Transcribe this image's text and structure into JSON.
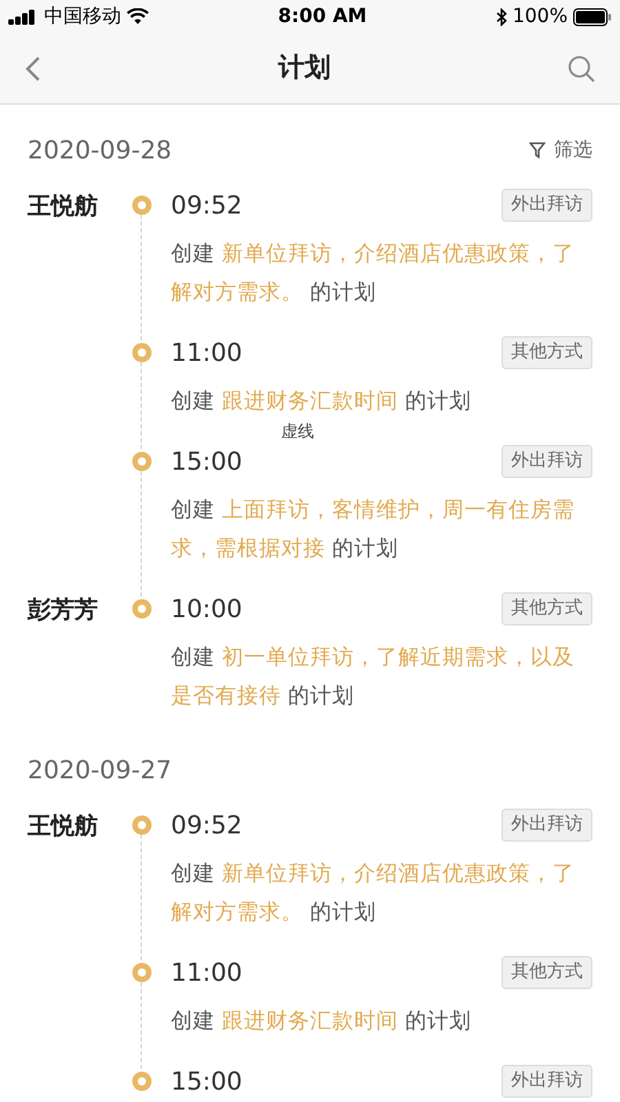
{
  "status_bar": {
    "carrier": "中国移动",
    "time": "8:00 AM",
    "battery": "100%"
  },
  "nav": {
    "title": "计划"
  },
  "filter": {
    "label": "筛选"
  },
  "groups": [
    {
      "date": "2020-09-28",
      "people": [
        {
          "name": "王悦舫",
          "entries": [
            {
              "time": "09:52",
              "tag": "外出拜访",
              "prefix": "创建",
              "subject": "新单位拜访，介绍酒店优惠政策，了解对方需求。",
              "suffix": "的计划"
            },
            {
              "time": "11:00",
              "tag": "其他方式",
              "prefix": "创建",
              "subject": "跟进财务汇款时间",
              "suffix": "的计划",
              "note": "虚线"
            },
            {
              "time": "15:00",
              "tag": "外出拜访",
              "prefix": "创建",
              "subject": "上面拜访，客情维护，周一有住房需求，需根据对接",
              "suffix": "的计划"
            }
          ]
        },
        {
          "name": "彭芳芳",
          "entries": [
            {
              "time": "10:00",
              "tag": "其他方式",
              "prefix": "创建",
              "subject": "初一单位拜访，了解近期需求，以及是否有接待",
              "suffix": "的计划"
            }
          ]
        }
      ]
    },
    {
      "date": "2020-09-27",
      "people": [
        {
          "name": "王悦舫",
          "entries": [
            {
              "time": "09:52",
              "tag": "外出拜访",
              "prefix": "创建",
              "subject": "新单位拜访，介绍酒店优惠政策，了解对方需求。",
              "suffix": "的计划"
            },
            {
              "time": "11:00",
              "tag": "其他方式",
              "prefix": "创建",
              "subject": "跟进财务汇款时间",
              "suffix": "的计划"
            },
            {
              "time": "15:00",
              "tag": "外出拜访"
            }
          ]
        }
      ]
    }
  ]
}
